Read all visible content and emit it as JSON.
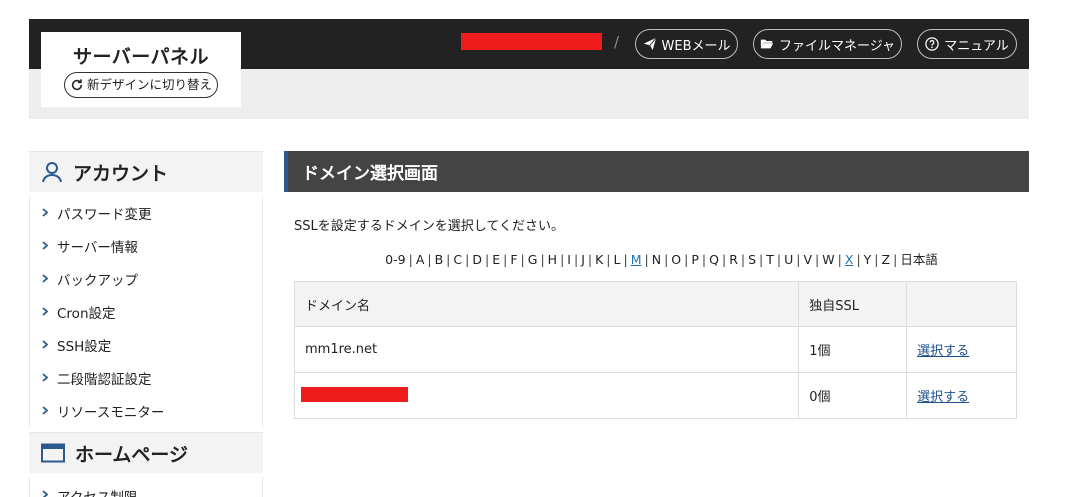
{
  "header": {
    "logo_title": "サーバーパネル",
    "new_design_label": "新デザインに切り替え",
    "separator": "/",
    "webmail_label": "WEBメール",
    "file_manager_label": "ファイルマネージャ",
    "manual_label": "マニュアル"
  },
  "sidebar": {
    "account": {
      "title": "アカウント",
      "items": [
        {
          "label": "パスワード変更"
        },
        {
          "label": "サーバー情報"
        },
        {
          "label": "バックアップ"
        },
        {
          "label": "Cron設定"
        },
        {
          "label": "SSH設定"
        },
        {
          "label": "二段階認証設定"
        },
        {
          "label": "リソースモニター"
        }
      ]
    },
    "homepage": {
      "title": "ホームページ",
      "items": [
        {
          "label": "アクセス制限"
        }
      ]
    }
  },
  "main": {
    "title": "ドメイン選択画面",
    "instruction": "SSLを設定するドメインを選択してください。",
    "alphabet": [
      {
        "label": "0-9",
        "link": false
      },
      {
        "label": "A",
        "link": false
      },
      {
        "label": "B",
        "link": false
      },
      {
        "label": "C",
        "link": false
      },
      {
        "label": "D",
        "link": false
      },
      {
        "label": "E",
        "link": false
      },
      {
        "label": "F",
        "link": false
      },
      {
        "label": "G",
        "link": false
      },
      {
        "label": "H",
        "link": false
      },
      {
        "label": "I",
        "link": false
      },
      {
        "label": "J",
        "link": false
      },
      {
        "label": "K",
        "link": false
      },
      {
        "label": "L",
        "link": false
      },
      {
        "label": "M",
        "link": true
      },
      {
        "label": "N",
        "link": false
      },
      {
        "label": "O",
        "link": false
      },
      {
        "label": "P",
        "link": false
      },
      {
        "label": "Q",
        "link": false
      },
      {
        "label": "R",
        "link": false
      },
      {
        "label": "S",
        "link": false
      },
      {
        "label": "T",
        "link": false
      },
      {
        "label": "U",
        "link": false
      },
      {
        "label": "V",
        "link": false
      },
      {
        "label": "W",
        "link": false
      },
      {
        "label": "X",
        "link": true
      },
      {
        "label": "Y",
        "link": false
      },
      {
        "label": "Z",
        "link": false
      },
      {
        "label": "日本語",
        "link": false
      }
    ],
    "table": {
      "headers": [
        "ドメイン名",
        "独自SSL",
        ""
      ],
      "rows": [
        {
          "domain": "mm1re.net",
          "ssl": "1個",
          "action": "選択する"
        },
        {
          "domain": "",
          "ssl": "0個",
          "action": "選択する"
        }
      ]
    }
  },
  "colors": {
    "header_bg": "#222222",
    "subbar_bg": "#eeeeee",
    "section_bg": "#444444",
    "accent_blue": "#2b5a8f",
    "redaction": "#ee1c1c",
    "link": "#1a73b8"
  },
  "icons": {
    "account": "user-icon",
    "homepage": "browser-window-icon",
    "webmail": "paper-plane-icon",
    "file_manager": "folder-open-icon",
    "manual": "question-circle-icon",
    "new_design": "refresh-icon"
  }
}
